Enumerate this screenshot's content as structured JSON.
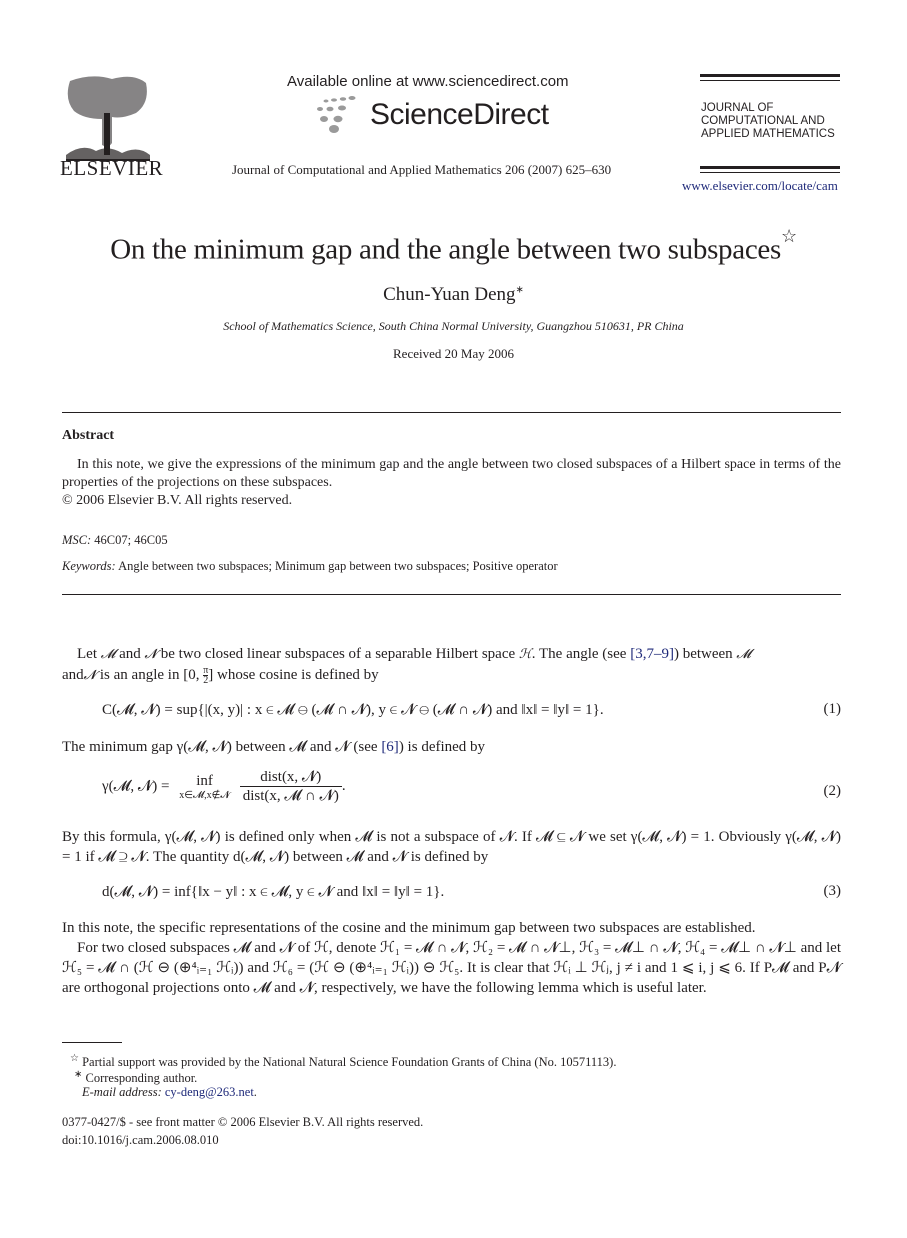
{
  "header": {
    "publisher": "ELSEVIER",
    "available_online": "Available online at www.sciencedirect.com",
    "sciencedirect": "ScienceDirect",
    "citation": "Journal of Computational and Applied Mathematics 206 (2007) 625–630",
    "journal_name_lines": [
      "JOURNAL OF",
      "COMPUTATIONAL AND",
      "APPLIED MATHEMATICS"
    ],
    "journal_url": "www.elsevier.com/locate/cam"
  },
  "article": {
    "title": "On the minimum gap and the angle between two subspaces",
    "title_mark": "☆",
    "author": "Chun-Yuan Deng",
    "author_mark": "∗",
    "affiliation": "School of Mathematics Science, South China Normal University, Guangzhou 510631, PR China",
    "received": "Received 20 May 2006"
  },
  "abstract": {
    "heading": "Abstract",
    "text": "In this note, we give the expressions of the minimum gap and the angle between two closed subspaces of a Hilbert space in terms of the properties of the projections on these subspaces.",
    "copyright": "© 2006 Elsevier B.V. All rights reserved.",
    "msc_label": "MSC:",
    "msc_value": "46C07; 46C05",
    "keywords_label": "Keywords:",
    "keywords_value": "Angle between two subspaces; Minimum gap between two subspaces; Positive operator"
  },
  "body": {
    "p1_a": "Let ",
    "p1_b": " and ",
    "p1_c": " be two closed linear subspaces of a separable Hilbert space ",
    "p1_d": ". The angle (see ",
    "p1_ref": "[3,7–9]",
    "p1_e": ") between ",
    "p1_f": "and ",
    "p1_g": " is an angle in [0, ",
    "p1_h": "] whose cosine is defined by",
    "eq1": "C(𝓜, 𝓝) = sup{|(x, y)| : x ∈ 𝓜 ⊖ (𝓜 ∩ 𝓝), y ∈ 𝓝 ⊖ (𝓜 ∩ 𝓝) and ‖x‖ = ‖y‖ = 1}.",
    "eq1_num": "(1)",
    "p2_a": "The minimum gap γ(𝓜, 𝓝) between 𝓜 and 𝓝 (see ",
    "p2_ref": "[6]",
    "p2_b": ") is defined by",
    "eq2_lhs": "γ(𝓜, 𝓝) =",
    "eq2_inf": "inf",
    "eq2_inf_sub": "x∈𝓜,x∉𝓝",
    "eq2_num_text": "dist(x, 𝓝)",
    "eq2_den_text": "dist(x, 𝓜 ∩ 𝓝)",
    "eq2_num": "(2)",
    "p3": "By this formula, γ(𝓜, 𝓝) is defined only when 𝓜 is not a subspace of 𝓝. If 𝓜 ⊆ 𝓝 we set γ(𝓜, 𝓝) = 1. Obviously γ(𝓜, 𝓝) = 1 if 𝓜 ⊇ 𝓝. The quantity d(𝓜, 𝓝) between 𝓜 and 𝓝 is defined by",
    "eq3": "d(𝓜, 𝓝) = inf{‖x − y‖ : x ∈ 𝓜, y ∈ 𝓝 and ‖x‖ = ‖y‖ = 1}.",
    "eq3_num": "(3)",
    "p4": "In this note, the specific representations of the cosine and the minimum gap between two subspaces are established.",
    "p5": "For two closed subspaces 𝓜 and 𝓝 of ℋ, denote ℋ₁ = 𝓜 ∩ 𝓝, ℋ₂ = 𝓜 ∩ 𝓝⊥, ℋ₃ = 𝓜⊥ ∩ 𝓝, ℋ₄ = 𝓜⊥ ∩ 𝓝⊥ and let ℋ₅ = 𝓜 ∩ (ℋ ⊖ (⊕⁴ᵢ₌₁ ℋᵢ)) and ℋ₆ = (ℋ ⊖ (⊕⁴ᵢ₌₁ ℋᵢ)) ⊖ ℋ₅. It is clear that ℋᵢ ⊥ ℋⱼ, j ≠ i and 1 ⩽ i, j ⩽ 6. If P𝓜 and P𝓝 are orthogonal projections onto 𝓜 and 𝓝, respectively, we have the following lemma which is useful later."
  },
  "footnotes": {
    "star_mark": "☆",
    "star_text": "Partial support was provided by the National Natural Science Foundation Grants of China (No. 10571113).",
    "corr_mark": "∗",
    "corr_text": "Corresponding author.",
    "email_label": "E-mail address:",
    "email": "cy-deng@263.net",
    "front_matter": "0377-0427/$ - see front matter © 2006 Elsevier B.V. All rights reserved.",
    "doi": "doi:10.1016/j.cam.2006.08.010"
  },
  "symbols": {
    "M": "𝓜",
    "N": "𝓝",
    "H": "ℋ",
    "pi_num": "π",
    "pi_den": "2"
  }
}
